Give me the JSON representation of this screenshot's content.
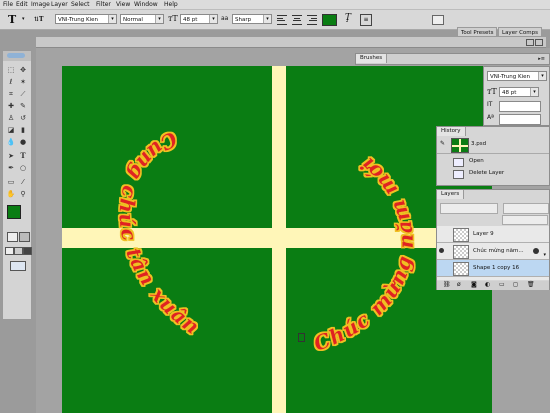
{
  "menu": [
    "File",
    "Edit",
    "Image",
    "Layer",
    "Select",
    "Filter",
    "View",
    "Window",
    "Help"
  ],
  "options": {
    "font_family": "VNI-Trung Kien",
    "font_style": "Normal",
    "font_size": "48 pt",
    "antialias": "Sharp",
    "text_color": "#0a7d13"
  },
  "top_tabs": [
    "Tool Presets",
    "Layer Comps"
  ],
  "brushes_panel": {
    "title": "Brushes"
  },
  "character_panel": {
    "font_family": "VNI-Trung Kien",
    "font_size": "48 pt"
  },
  "history_panel": {
    "title": "History",
    "snapshot": "3.psd",
    "items": [
      "Open",
      "Delete Layer"
    ]
  },
  "layers_panel": {
    "title": "Layers",
    "layers": [
      {
        "name": "Layer 9",
        "selected": false
      },
      {
        "name": "Chúc mừng năm...",
        "selected": false
      },
      {
        "name": "Shape 1 copy 16",
        "selected": true
      }
    ]
  },
  "canvas_text": {
    "left_arc": "Cung chúc tân xuân",
    "right_arc": "Chúc mừng năm mới",
    "left_first": "C",
    "right_first": "C"
  },
  "colors": {
    "canvas_green": "#0a7d13",
    "band": "#fff6b8",
    "text_red": "#e02424",
    "foreground": "#0a7d13",
    "background": "#ffffff"
  }
}
